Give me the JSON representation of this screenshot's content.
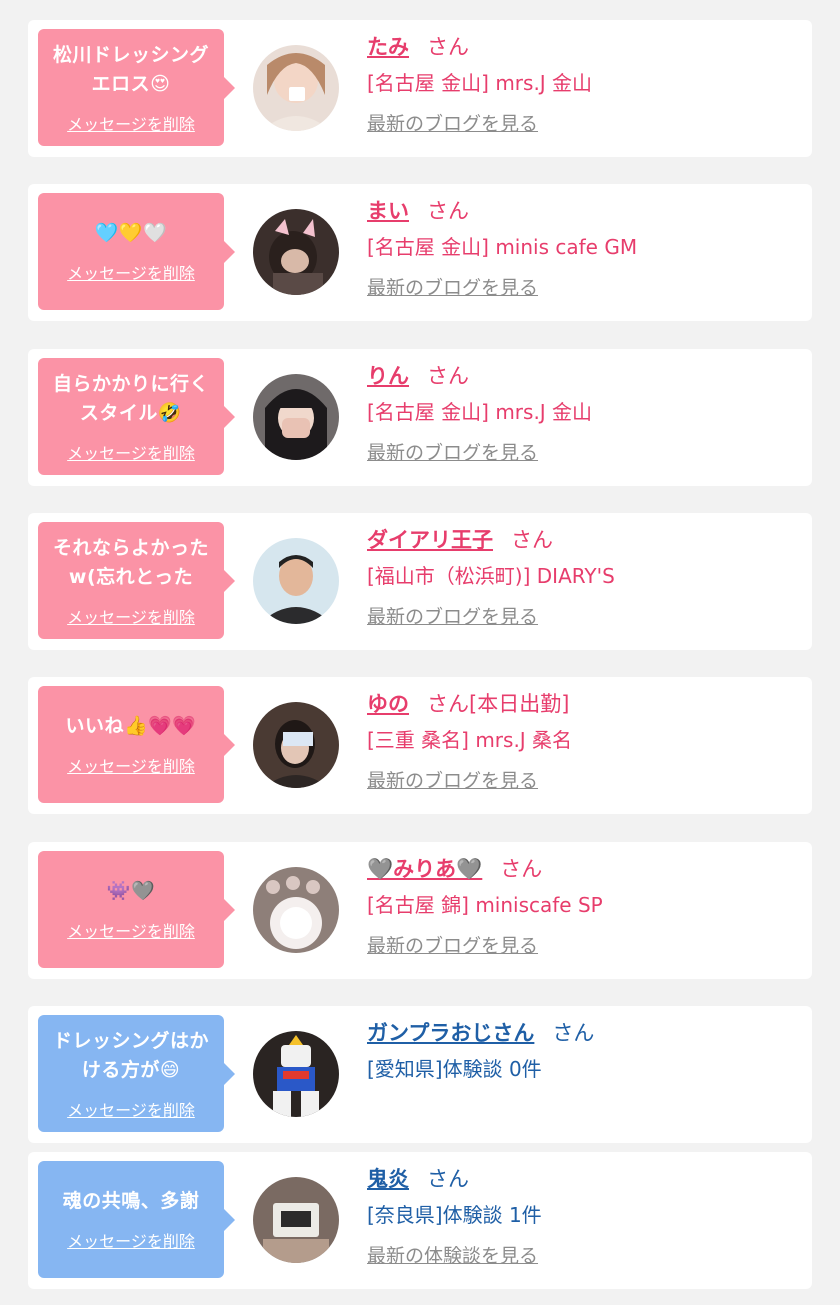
{
  "delete_label": "メッセージを削除",
  "colors": {
    "pink": "#fb93a6",
    "blue": "#86b6f2",
    "pink_text": "#e73d6c",
    "blue_text": "#1f5fa6",
    "background": "#f2f2f2"
  },
  "entries": [
    {
      "message": "松川ドレッシング\nエロス😍",
      "bubble_color": "pink",
      "name": "たみ",
      "suffix": "さん",
      "shop": "[名古屋 金山] mrs.J 金山",
      "link": "最新のブログを見る"
    },
    {
      "message": "🩵💛🤍",
      "bubble_color": "pink",
      "name": "まい",
      "suffix": "さん",
      "shop": "[名古屋 金山] minis cafe GM",
      "link": "最新のブログを見る"
    },
    {
      "message": "自らかかりに行く\nスタイル🤣",
      "bubble_color": "pink",
      "name": "りん",
      "suffix": "さん",
      "shop": "[名古屋 金山] mrs.J 金山",
      "link": "最新のブログを見る"
    },
    {
      "message": "それならよかった\nw(忘れとった",
      "bubble_color": "pink",
      "name": "ダイアリ王子",
      "suffix": "さん",
      "shop": "[福山市（松浜町)] DIARY'S",
      "link": "最新のブログを見る"
    },
    {
      "message": "いいね👍💗💗",
      "bubble_color": "pink",
      "name": "ゆの",
      "suffix": "さん[本日出勤]",
      "shop": "[三重 桑名] mrs.J 桑名",
      "link": "最新のブログを見る"
    },
    {
      "message": "👾🩶",
      "bubble_color": "pink",
      "name": "🩶みりあ🩶",
      "suffix": "さん",
      "shop": "[名古屋 錦] miniscafe SP",
      "link": "最新のブログを見る"
    },
    {
      "message": "ドレッシングはか\nける方が😄",
      "bubble_color": "blue",
      "name": "ガンプラおじさん",
      "suffix": "さん",
      "shop": "[愛知県]体験談 0件",
      "link": ""
    },
    {
      "message": "魂の共鳴、多謝",
      "bubble_color": "blue",
      "name": "鬼炎",
      "suffix": "さん",
      "shop": "[奈良県]体験談 1件",
      "link": "最新の体験談を見る"
    }
  ]
}
